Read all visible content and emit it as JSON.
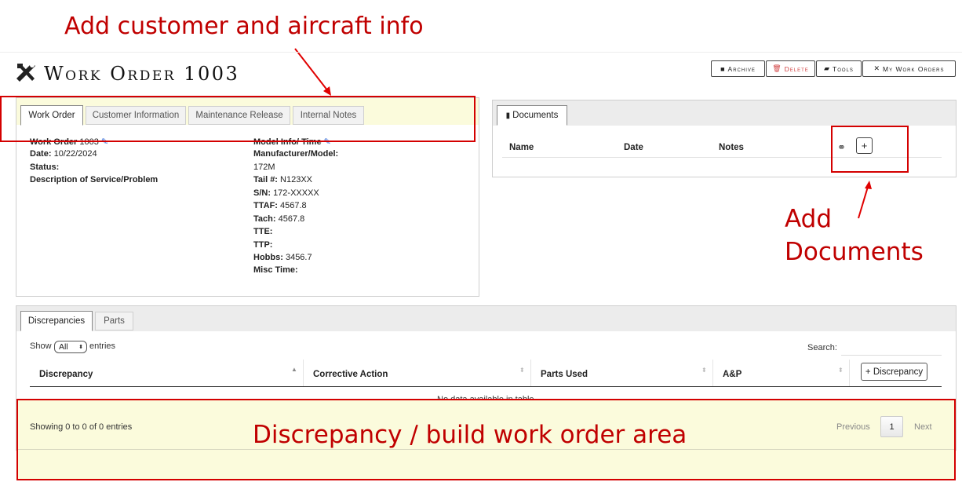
{
  "annotations": {
    "top": "Add customer and aircraft info",
    "docs_line1": "Add",
    "docs_line2": "Documents",
    "bottom": "Discrepancy / build work order area"
  },
  "header": {
    "title": "Work Order 1003",
    "buttons": {
      "archive": "Archive",
      "delete": "Delete",
      "tools": "Tools",
      "my_orders": "My Work Orders"
    }
  },
  "tabs": [
    "Work Order",
    "Customer Information",
    "Maintenance Release",
    "Internal Notes"
  ],
  "work_order": {
    "left": {
      "work_order_label": "Work Order",
      "work_order_value": "1003",
      "date_label": "Date:",
      "date_value": "10/22/2024",
      "status_label": "Status:",
      "description_label": "Description of Service/Problem"
    },
    "right": {
      "model_info": "Model Info/ Time",
      "manufacturer_label": "Manufacturer/Model:",
      "manufacturer_value": "172M",
      "tail_label": "Tail #:",
      "tail_value": "N123XX",
      "sn_label": "S/N:",
      "sn_value": "172-XXXXX",
      "ttaf_label": "TTAF:",
      "ttaf_value": "4567.8",
      "tach_label": "Tach:",
      "tach_value": "4567.8",
      "tte_label": "TTE:",
      "ttp_label": "TTP:",
      "hobbs_label": "Hobbs:",
      "hobbs_value": "3456.7",
      "misc_label": "Misc Time:"
    }
  },
  "documents": {
    "tab": "Documents",
    "columns": [
      "Name",
      "Date",
      "Notes"
    ]
  },
  "discrepancies": {
    "tabs": [
      "Discrepancies",
      "Parts"
    ],
    "show_label": "Show",
    "show_value": "All",
    "entries_label": "entries",
    "search_label": "Search:",
    "columns": [
      "Discrepancy",
      "Corrective Action",
      "Parts Used",
      "A&P"
    ],
    "add_button": "+ Discrepancy",
    "empty": "No data available in table",
    "showing": "Showing 0 to 0 of 0 entries",
    "pagination": {
      "previous": "Previous",
      "page": "1",
      "next": "Next"
    }
  }
}
